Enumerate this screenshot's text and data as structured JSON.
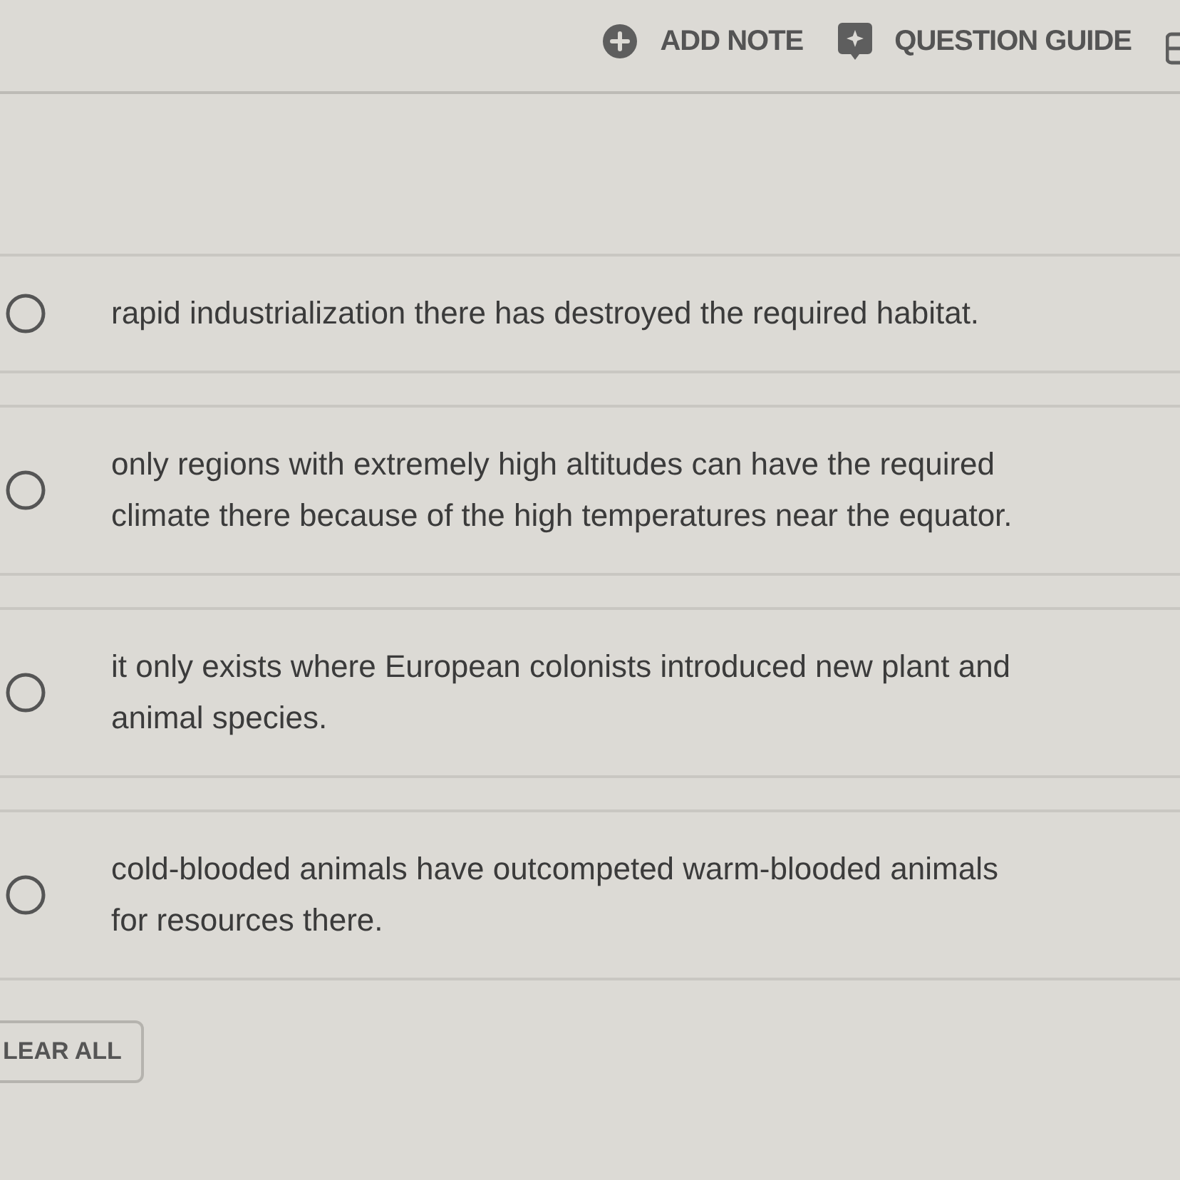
{
  "toolbar": {
    "buttons": [
      {
        "kind": "add",
        "label": "ADD NOTE"
      },
      {
        "kind": "guide",
        "label": "QUESTION GUIDE"
      }
    ]
  },
  "options": [
    {
      "lines": [
        "rapid industrialization there has destroyed the required habitat."
      ],
      "selected": false
    },
    {
      "lines": [
        "only regions with extremely high altitudes can have the required",
        "climate there because of the high temperatures near the equator."
      ],
      "selected": false
    },
    {
      "lines": [
        "it only exists where European colonists introduced new plant and",
        "animal species."
      ],
      "selected": false
    },
    {
      "lines": [
        "cold-blooded animals have outcompeted warm-blooded animals",
        "for resources there."
      ],
      "selected": false
    }
  ],
  "clear_button": {
    "label": "LEAR ALL"
  }
}
